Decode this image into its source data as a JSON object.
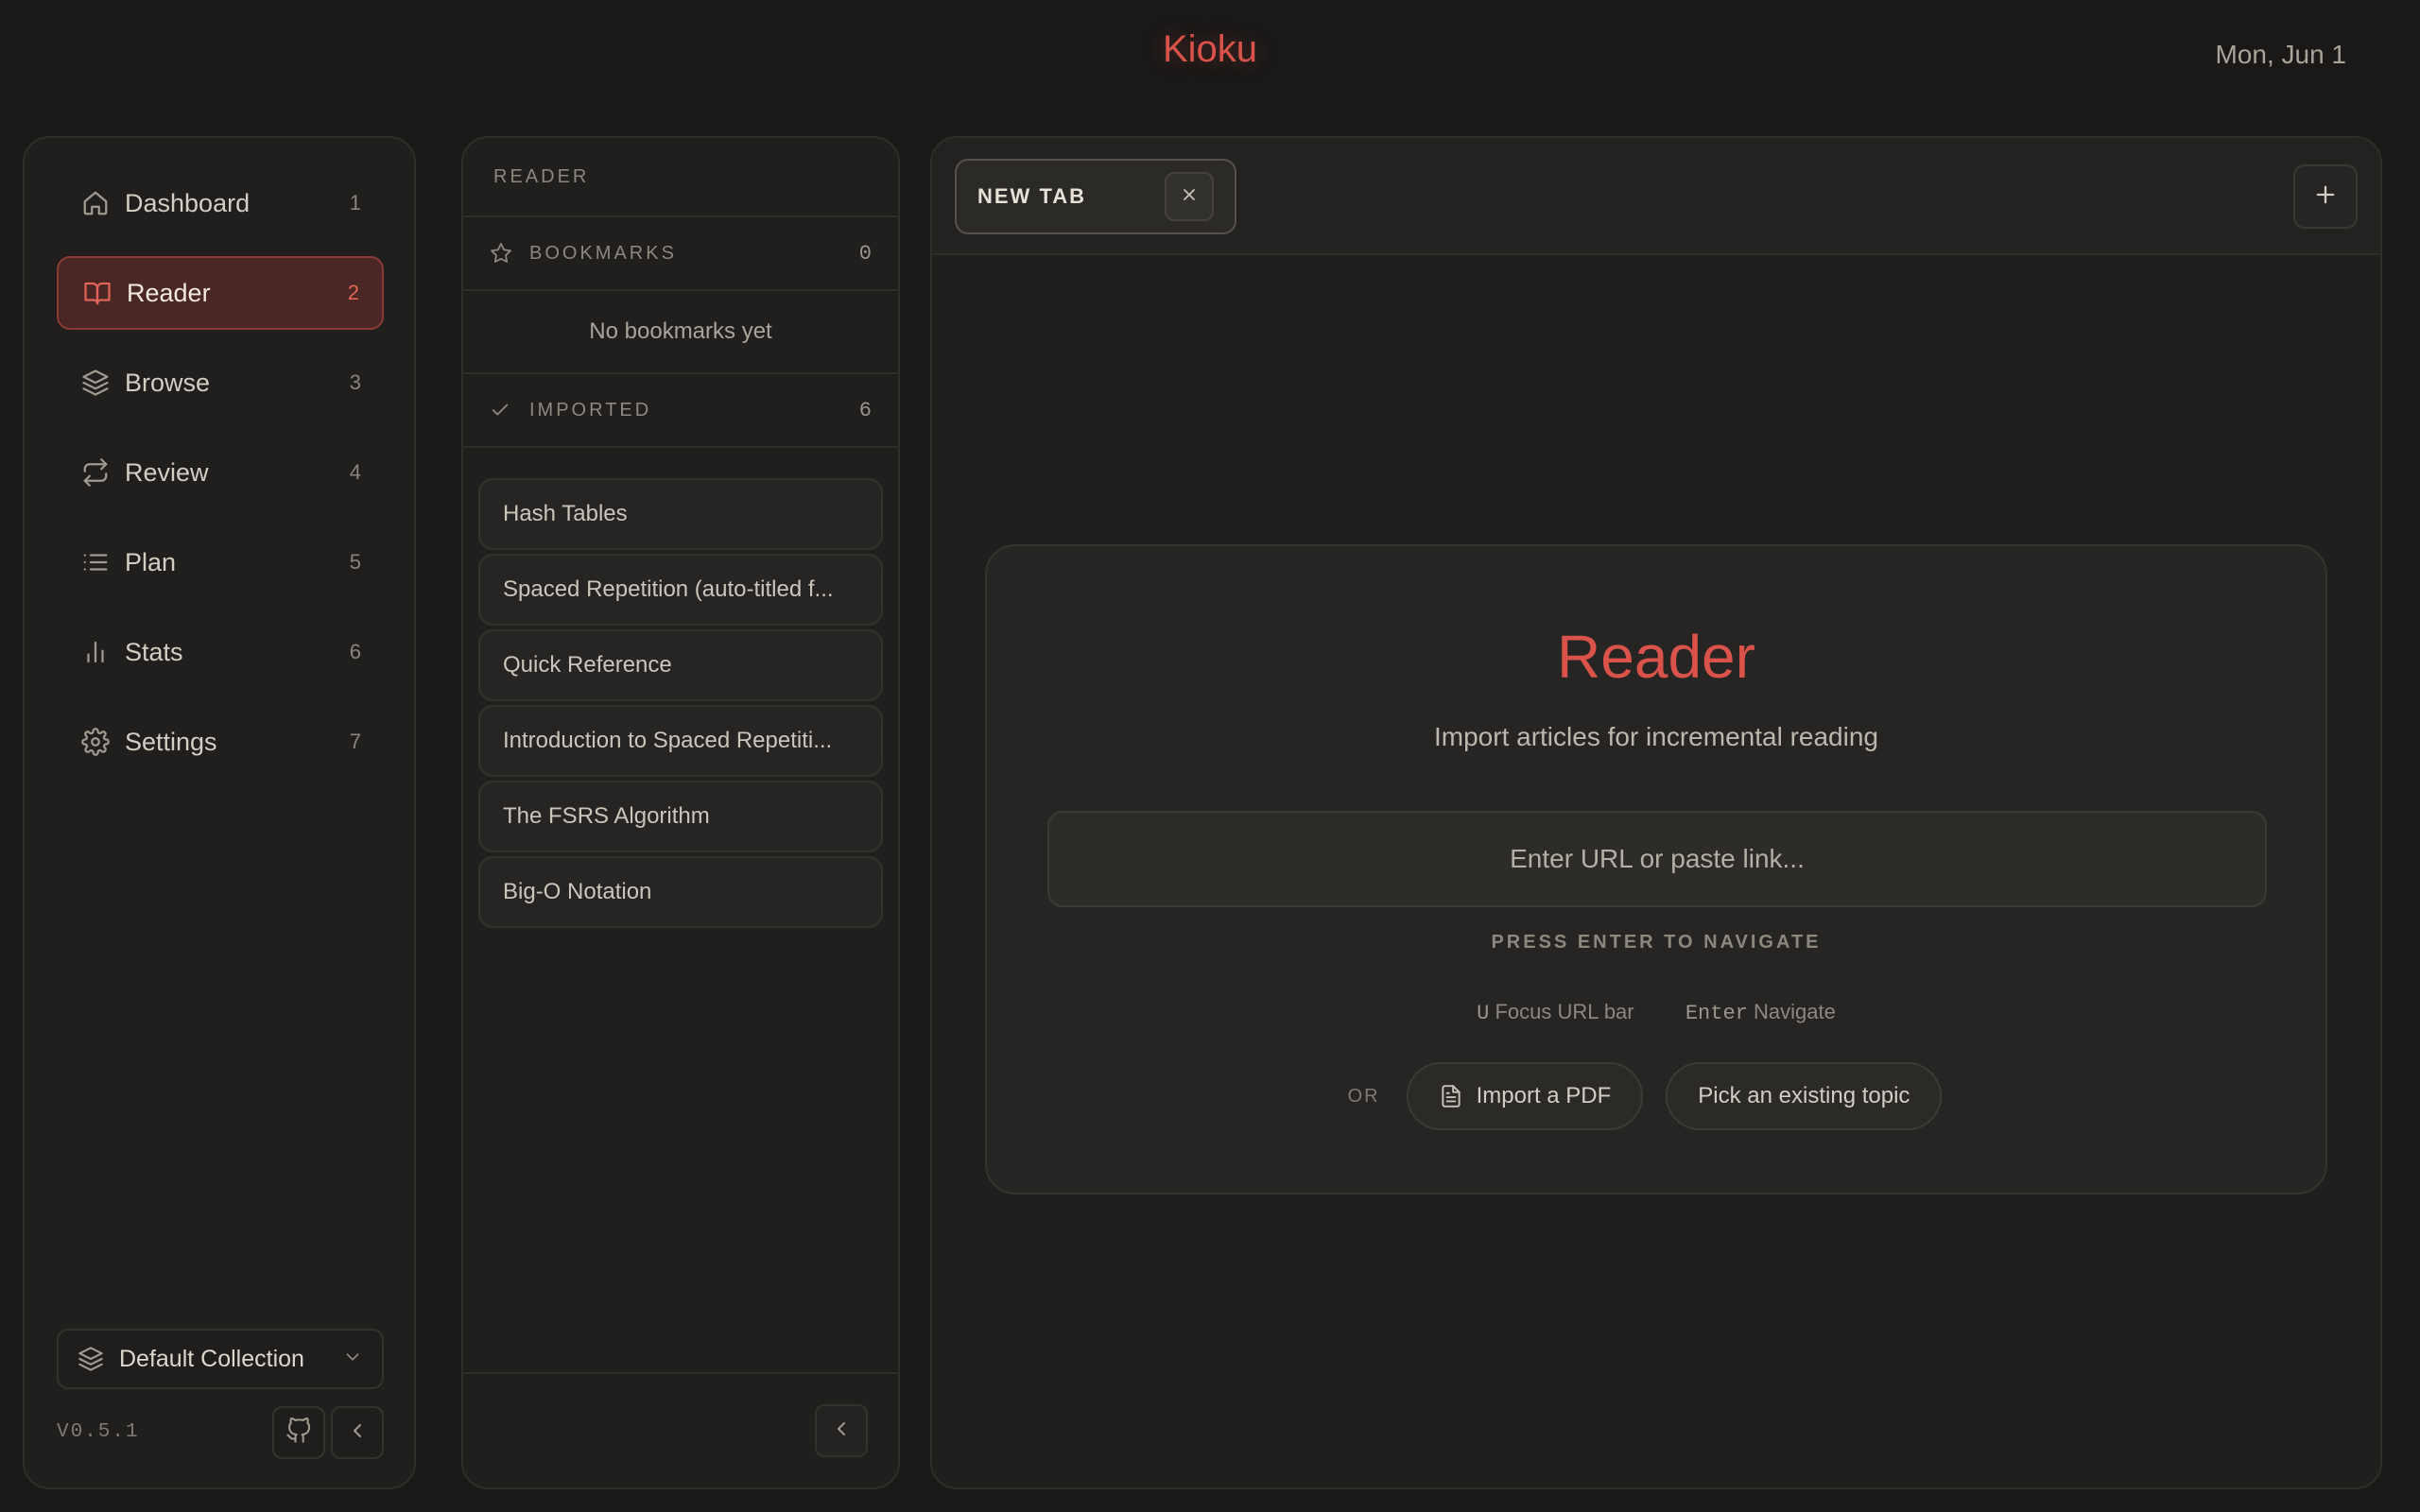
{
  "app": {
    "title": "Kioku",
    "date": "Mon, Jun 1",
    "accent": "#d9534a"
  },
  "sidebar": {
    "items": [
      {
        "label": "Dashboard",
        "num": "1",
        "icon": "home-icon"
      },
      {
        "label": "Reader",
        "num": "2",
        "icon": "book-open-icon",
        "active": true
      },
      {
        "label": "Browse",
        "num": "3",
        "icon": "layers-icon"
      },
      {
        "label": "Review",
        "num": "4",
        "icon": "repeat-icon"
      },
      {
        "label": "Plan",
        "num": "5",
        "icon": "list-icon"
      },
      {
        "label": "Stats",
        "num": "6",
        "icon": "bar-chart-icon"
      },
      {
        "label": "Settings",
        "num": "7",
        "icon": "gear-icon"
      }
    ],
    "collection": "Default Collection",
    "version": "V0.5.1"
  },
  "reader_panel": {
    "header": "READER",
    "bookmarks": {
      "label": "BOOKMARKS",
      "count": "0",
      "empty": "No bookmarks yet"
    },
    "imported": {
      "label": "IMPORTED",
      "count": "6",
      "items": [
        "Hash Tables",
        "Spaced Repetition (auto-titled f...",
        "Quick Reference",
        "Introduction to Spaced Repetiti...",
        "The FSRS Algorithm",
        "Big-O Notation"
      ]
    }
  },
  "main": {
    "tab": {
      "label": "NEW TAB"
    },
    "card": {
      "title": "Reader",
      "subtitle": "Import articles for incremental reading",
      "url_placeholder": "Enter URL or paste link...",
      "hint": "PRESS ENTER TO NAVIGATE",
      "shortcut1_key": "U",
      "shortcut1_label": "Focus URL bar",
      "shortcut2_key": "Enter",
      "shortcut2_label": "Navigate",
      "or_label": "OR",
      "import_pdf": "Import a PDF",
      "pick_topic": "Pick an existing topic"
    }
  }
}
